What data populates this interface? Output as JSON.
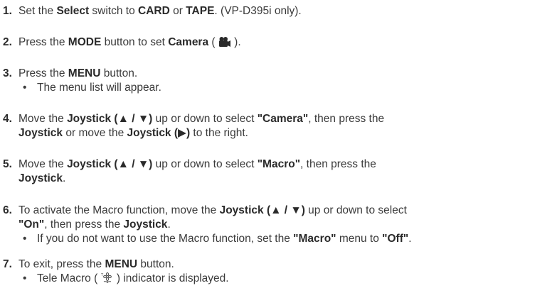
{
  "steps": [
    {
      "number": "1.",
      "parts": [
        "Set the ",
        "Select",
        " switch to ",
        "CARD",
        " or ",
        "TAPE",
        ". (VP-D395i only)."
      ]
    },
    {
      "number": "2.",
      "parts": [
        "Press the ",
        "MODE",
        " button to set ",
        "Camera",
        " ( ",
        " )."
      ],
      "icon": "camcorder-icon"
    },
    {
      "number": "3.",
      "parts": [
        "Press the ",
        "MENU",
        " button."
      ],
      "bullets": [
        "The menu list will appear."
      ]
    },
    {
      "number": "4.",
      "parts": [
        "Move the ",
        "Joystick (▲ / ▼)",
        " up or down to select ",
        "\"Camera\"",
        ", then press the",
        "Joystick",
        " or move the ",
        "Joystick (▶)",
        " to the right."
      ]
    },
    {
      "number": "5.",
      "parts": [
        "Move the ",
        "Joystick (▲ / ▼)",
        " up or down to select ",
        "\"Macro\"",
        ", then press the",
        "Joystick",
        "."
      ]
    },
    {
      "number": "6.",
      "parts": [
        "To activate the Macro function, move the ",
        "Joystick (▲ / ▼)",
        " up or down to select",
        "\"On\"",
        ", then press the ",
        "Joystick",
        "."
      ],
      "bullets": [
        [
          "If you do not want to use the Macro function, set the ",
          "\"Macro\"",
          " menu to ",
          "\"Off\"",
          "."
        ]
      ]
    },
    {
      "number": "7.",
      "parts": [
        "To exit, press the ",
        "MENU",
        " button."
      ],
      "bullets": [
        [
          "Tele Macro ( ",
          " ) indicator is displayed."
        ]
      ],
      "bullet_icon": "tele-macro-flower-icon"
    }
  ],
  "bullet_char": "•"
}
